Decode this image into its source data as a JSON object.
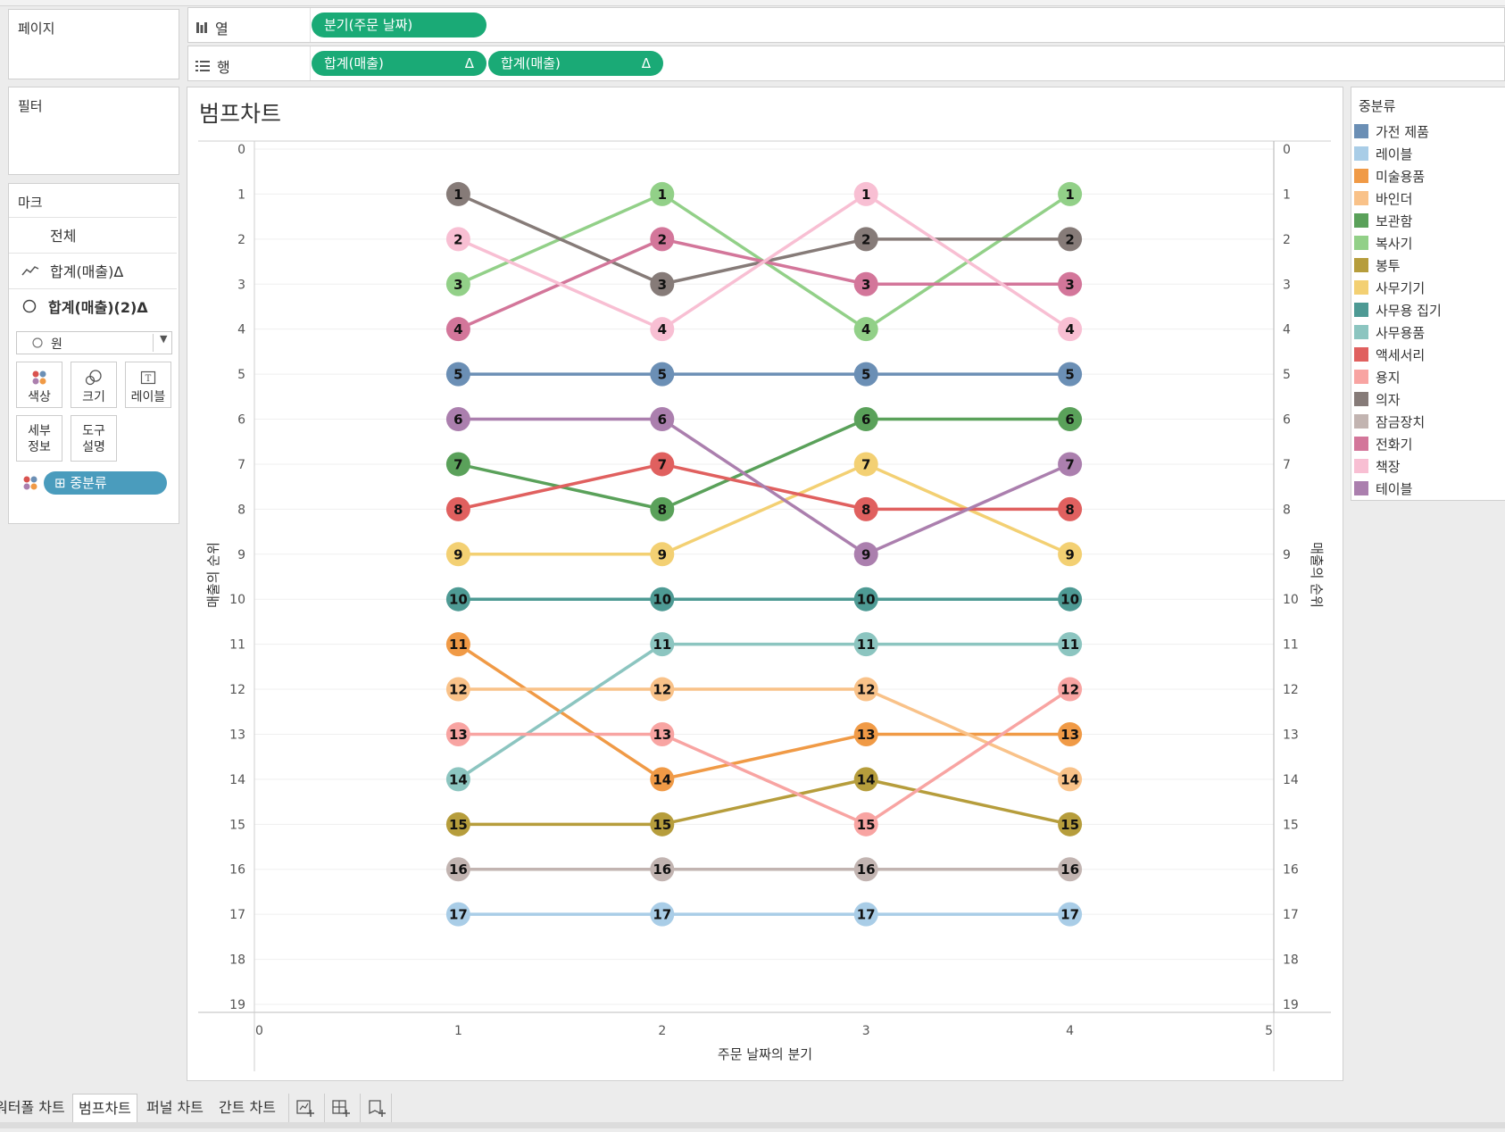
{
  "shelves": {
    "pages_label": "페이지",
    "filters_label": "필터",
    "columns_label": "열",
    "rows_label": "행",
    "columns_pill": "분기(주문 날짜)",
    "rows_pill_1": "합계(매출)",
    "rows_pill_2": "합계(매출)",
    "delta": "Δ"
  },
  "marks": {
    "title": "마크",
    "all": "전체",
    "layer1": "합계(매출)Δ",
    "layer2": "합계(매출)(2)Δ",
    "mark_type": "원",
    "color": "색상",
    "size": "크기",
    "label": "레이블",
    "detail_1": "세부",
    "detail_2": "정보",
    "tooltip_1": "도구",
    "tooltip_2": "설명",
    "field_pill": "⊞ 중분류"
  },
  "legend": {
    "title": "중분류",
    "items": [
      {
        "name": "가전 제품",
        "color": "#6b8fb5"
      },
      {
        "name": "레이블",
        "color": "#a9cde7"
      },
      {
        "name": "미술용품",
        "color": "#f09a46"
      },
      {
        "name": "바인더",
        "color": "#f9c289"
      },
      {
        "name": "보관함",
        "color": "#5aa15a"
      },
      {
        "name": "복사기",
        "color": "#92d088"
      },
      {
        "name": "봉투",
        "color": "#b69d3c"
      },
      {
        "name": "사무기기",
        "color": "#f3d073"
      },
      {
        "name": "사무용 집기",
        "color": "#4e9a94"
      },
      {
        "name": "사무용품",
        "color": "#8cc5c0"
      },
      {
        "name": "액세서리",
        "color": "#e0605f"
      },
      {
        "name": "용지",
        "color": "#f8a4a2"
      },
      {
        "name": "의자",
        "color": "#867b78"
      },
      {
        "name": "잠금장치",
        "color": "#c2b4b1"
      },
      {
        "name": "전화기",
        "color": "#d3769a"
      },
      {
        "name": "책장",
        "color": "#f8bfd3"
      },
      {
        "name": "테이블",
        "color": "#ab7fae"
      }
    ]
  },
  "tabs": {
    "waterfall": "워터폴 차트",
    "bump": "범프차트",
    "funnel": "퍼널 차트",
    "gantt": "간트 차트"
  },
  "chart_data": {
    "type": "line",
    "title": "범프차트",
    "xlabel": "주문 날짜의 분기",
    "ylabel": "매출의 순위",
    "ylabel_right": "매출의 순위",
    "x": [
      1,
      2,
      3,
      4
    ],
    "xlim": [
      0,
      5
    ],
    "xticks": [
      0,
      1,
      2,
      3,
      4,
      5
    ],
    "ylim": [
      0,
      19
    ],
    "yticks": [
      0,
      1,
      2,
      3,
      4,
      5,
      6,
      7,
      8,
      9,
      10,
      11,
      12,
      13,
      14,
      15,
      16,
      17,
      18,
      19
    ],
    "y_reversed": true,
    "grid": true,
    "series": [
      {
        "name": "가전 제품",
        "color": "#6b8fb5",
        "values": [
          5,
          5,
          5,
          5
        ]
      },
      {
        "name": "레이블",
        "color": "#a9cde7",
        "values": [
          17,
          17,
          17,
          17
        ]
      },
      {
        "name": "미술용품",
        "color": "#f09a46",
        "values": [
          11,
          14,
          13,
          13
        ]
      },
      {
        "name": "바인더",
        "color": "#f9c289",
        "values": [
          12,
          12,
          12,
          14
        ]
      },
      {
        "name": "보관함",
        "color": "#5aa15a",
        "values": [
          7,
          8,
          6,
          6
        ]
      },
      {
        "name": "복사기",
        "color": "#92d088",
        "values": [
          3,
          1,
          4,
          1
        ]
      },
      {
        "name": "봉투",
        "color": "#b69d3c",
        "values": [
          15,
          15,
          14,
          15
        ]
      },
      {
        "name": "사무기기",
        "color": "#f3d073",
        "values": [
          9,
          9,
          7,
          9
        ]
      },
      {
        "name": "사무용 집기",
        "color": "#4e9a94",
        "values": [
          10,
          10,
          10,
          10
        ]
      },
      {
        "name": "사무용품",
        "color": "#8cc5c0",
        "values": [
          14,
          11,
          11,
          11
        ]
      },
      {
        "name": "액세서리",
        "color": "#e0605f",
        "values": [
          8,
          7,
          8,
          8
        ]
      },
      {
        "name": "용지",
        "color": "#f8a4a2",
        "values": [
          13,
          13,
          15,
          12
        ]
      },
      {
        "name": "의자",
        "color": "#867b78",
        "values": [
          1,
          3,
          2,
          2
        ]
      },
      {
        "name": "잠금장치",
        "color": "#c2b4b1",
        "values": [
          16,
          16,
          16,
          16
        ]
      },
      {
        "name": "전화기",
        "color": "#d3769a",
        "values": [
          4,
          2,
          3,
          3
        ]
      },
      {
        "name": "책장",
        "color": "#f8bfd3",
        "values": [
          2,
          4,
          1,
          4
        ]
      },
      {
        "name": "테이블",
        "color": "#ab7fae",
        "values": [
          6,
          6,
          9,
          7
        ]
      }
    ]
  }
}
